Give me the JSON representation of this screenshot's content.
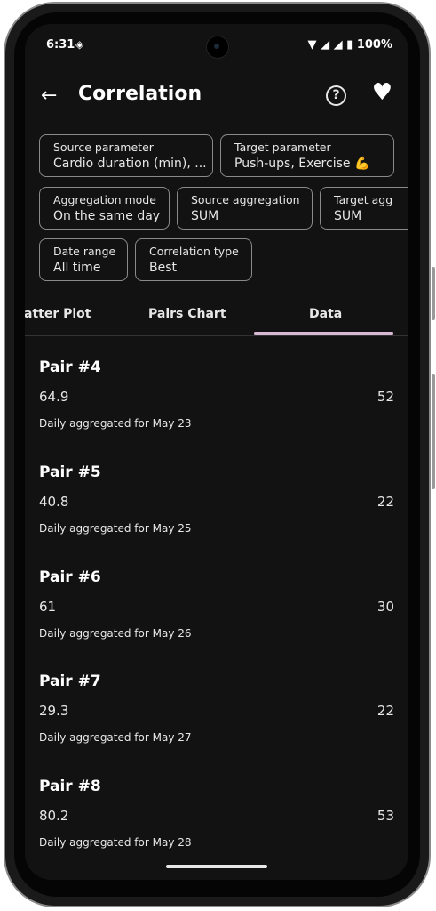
{
  "status": {
    "time": "6:31",
    "battery": "100%"
  },
  "appbar": {
    "title": "Correlation"
  },
  "filters": [
    {
      "label": "Source parameter",
      "value": "Cardio duration (min), ..."
    },
    {
      "label": "Target parameter",
      "value": "Push-ups, Exercise 💪"
    },
    {
      "label": "Aggregation mode",
      "value": "On the same day"
    },
    {
      "label": "Source aggregation",
      "value": "SUM"
    },
    {
      "label": "Target agg",
      "value": "SUM"
    },
    {
      "label": "Date range",
      "value": "All time"
    },
    {
      "label": "Correlation type",
      "value": "Best"
    }
  ],
  "tabs": [
    "atter Plot",
    "Pairs Chart",
    "Data"
  ],
  "pairs": [
    {
      "title": "Pair #4",
      "source": "64.9",
      "target": "52",
      "desc": "Daily aggregated for May 23"
    },
    {
      "title": "Pair #5",
      "source": "40.8",
      "target": "22",
      "desc": "Daily aggregated for May 25"
    },
    {
      "title": "Pair #6",
      "source": "61",
      "target": "30",
      "desc": "Daily aggregated for May 26"
    },
    {
      "title": "Pair #7",
      "source": "29.3",
      "target": "22",
      "desc": "Daily aggregated for May 27"
    },
    {
      "title": "Pair #8",
      "source": "80.2",
      "target": "53",
      "desc": "Daily aggregated for May 28"
    }
  ],
  "colors": {
    "background": "#121212",
    "tab_indicator": "#d9b8d6"
  }
}
